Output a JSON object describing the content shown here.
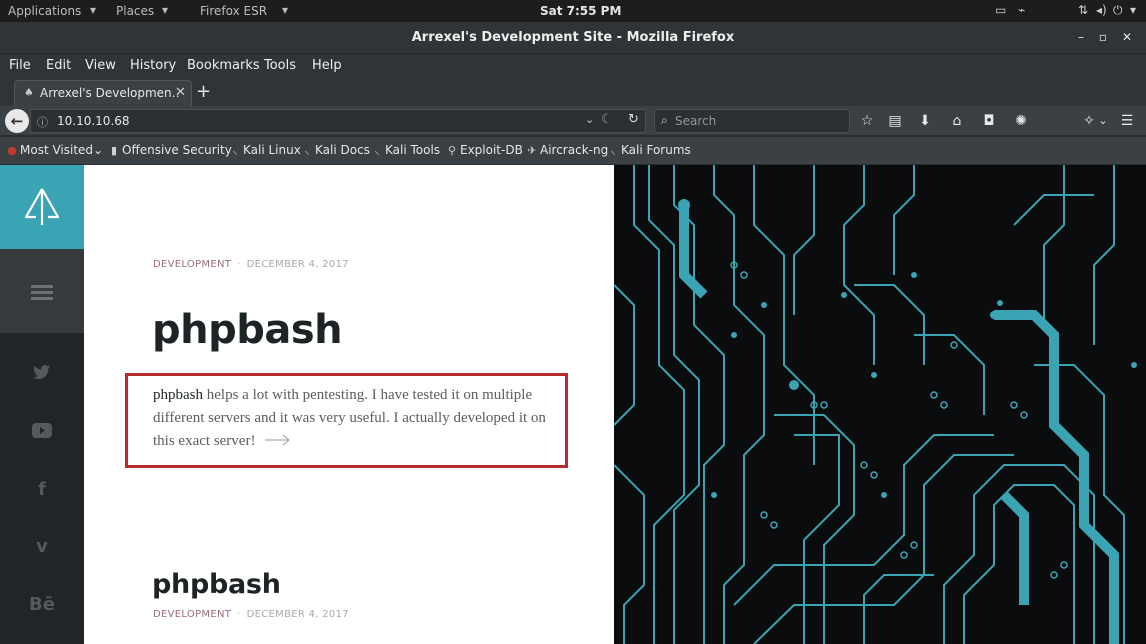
{
  "top_bar": {
    "applications": "Applications",
    "places": "Places",
    "app_menu": "Firefox ESR",
    "clock": "Sat  7:55 PM"
  },
  "window": {
    "title": "Arrexel's Development Site - Mozilla Firefox",
    "minimize": "–",
    "maximize": "▫",
    "close": "✕"
  },
  "menu": {
    "file": "File",
    "edit": "Edit",
    "view": "View",
    "history": "History",
    "bookmarks": "Bookmarks",
    "tools": "Tools",
    "help": "Help"
  },
  "tab": {
    "label": "Arrexel's Developmen…",
    "close": "✕",
    "new_tab": "+"
  },
  "nav": {
    "url": "10.10.10.68",
    "search_placeholder": "Search"
  },
  "bookmarks_bar": [
    {
      "label": "Most Visited",
      "icon": "firefox-icon"
    },
    {
      "label": "Offensive Security",
      "icon": "offsec-icon"
    },
    {
      "label": "Kali Linux",
      "icon": "kali-dragon-icon"
    },
    {
      "label": "Kali Docs",
      "icon": "kali-dragon-icon"
    },
    {
      "label": "Kali Tools",
      "icon": "kali-dragon-icon"
    },
    {
      "label": "Exploit-DB",
      "icon": "exploitdb-icon"
    },
    {
      "label": "Aircrack-ng",
      "icon": "aircrack-icon"
    },
    {
      "label": "Kali Forums",
      "icon": "kali-dragon-icon"
    }
  ],
  "post1": {
    "category": "DEVELOPMENT",
    "separator": "·",
    "date": "DECEMBER 4, 2017",
    "title": "phpbash",
    "excerpt_strong": "phpbash",
    "excerpt_rest": " helps a lot with pentesting. I have tested it on multiple different servers and it was very useful. I actually developed it on this exact server!"
  },
  "post2": {
    "title": "phpbash",
    "category": "DEVELOPMENT",
    "separator": "·",
    "date": "DECEMBER 4, 2017"
  },
  "colors": {
    "accent": "#3aa4b4",
    "highlight_border": "#b82b2e",
    "category": "#9a6c7e",
    "circuit": "#3aa4b4"
  }
}
